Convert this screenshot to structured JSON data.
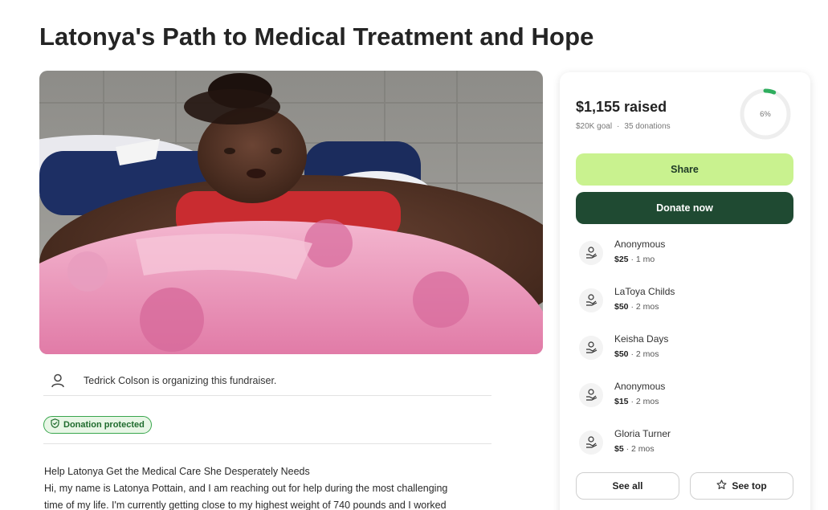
{
  "page": {
    "title": "Latonya's Path to Medical Treatment and Hope"
  },
  "organizer": {
    "icon": "person-icon",
    "text": "Tedrick Colson is organizing this fundraiser."
  },
  "badge": {
    "icon": "shield-check-icon",
    "label": "Donation protected",
    "color": "#39a64d"
  },
  "story": {
    "heading": "Help Latonya Get the Medical Care She Desperately Needs",
    "line1": "Hi, my name is Latonya Pottain, and I am reaching out for help during the most challenging",
    "line2": "time of my life. I'm currently getting close to my highest weight of 740 pounds and I worked"
  },
  "sidebar": {
    "raised": "$1,155 raised",
    "goal": "$20K goal",
    "donation_count": "35 donations",
    "progress_percent": 6,
    "progress_label": "6%",
    "progress_color": "#2fae5e",
    "share_label": "Share",
    "donate_label": "Donate now",
    "donations": [
      {
        "name": "Anonymous",
        "amount": "$25",
        "time": "1 mo"
      },
      {
        "name": "LaToya Childs",
        "amount": "$50",
        "time": "2 mos"
      },
      {
        "name": "Keisha Days",
        "amount": "$50",
        "time": "2 mos"
      },
      {
        "name": "Anonymous",
        "amount": "$15",
        "time": "2 mos"
      },
      {
        "name": "Gloria Turner",
        "amount": "$5",
        "time": "2 mos"
      }
    ],
    "see_all_label": "See all",
    "see_top_label": "See top",
    "see_top_icon": "star-icon"
  },
  "colors": {
    "share_bg": "#c9f28f",
    "donate_bg": "#1f4a32"
  }
}
